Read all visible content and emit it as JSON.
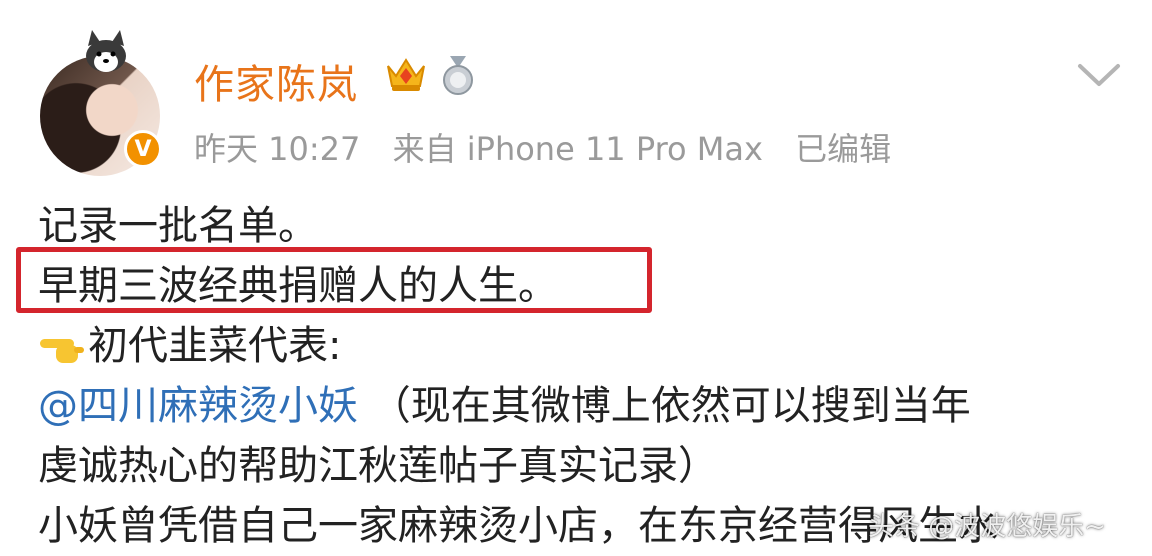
{
  "post": {
    "author": "作家陈岚",
    "time": "昨天 10:27",
    "source": "来自 iPhone 11 Pro Max",
    "edited": "已编辑",
    "lines": {
      "l1": "记录一批名单。",
      "l2": "早期三波经典捐赠人的人生。",
      "l3_text": "初代韭菜代表:",
      "l4_mention": "@四川麻辣烫小妖",
      "l4_text": " （现在其微博上依然可以搜到当年",
      "l5": "虔诚热心的帮助江秋莲帖子真实记录）",
      "l6": "小妖曾凭借自己一家麻辣烫小店，在东京经营得风生水"
    }
  },
  "watermark": "头条 @波波悠娱乐~",
  "colors": {
    "username": "#e8741a",
    "meta": "#9a9a9a",
    "mention": "#2f6fb7",
    "highlight_border": "#d4252d",
    "verified": "#f29100"
  },
  "icons": {
    "verified": "v-badge-icon",
    "crown": "crown-badge-icon",
    "medal": "medal-badge-icon",
    "menu": "chevron-down-icon",
    "pointing": "pointing-hand-icon"
  }
}
